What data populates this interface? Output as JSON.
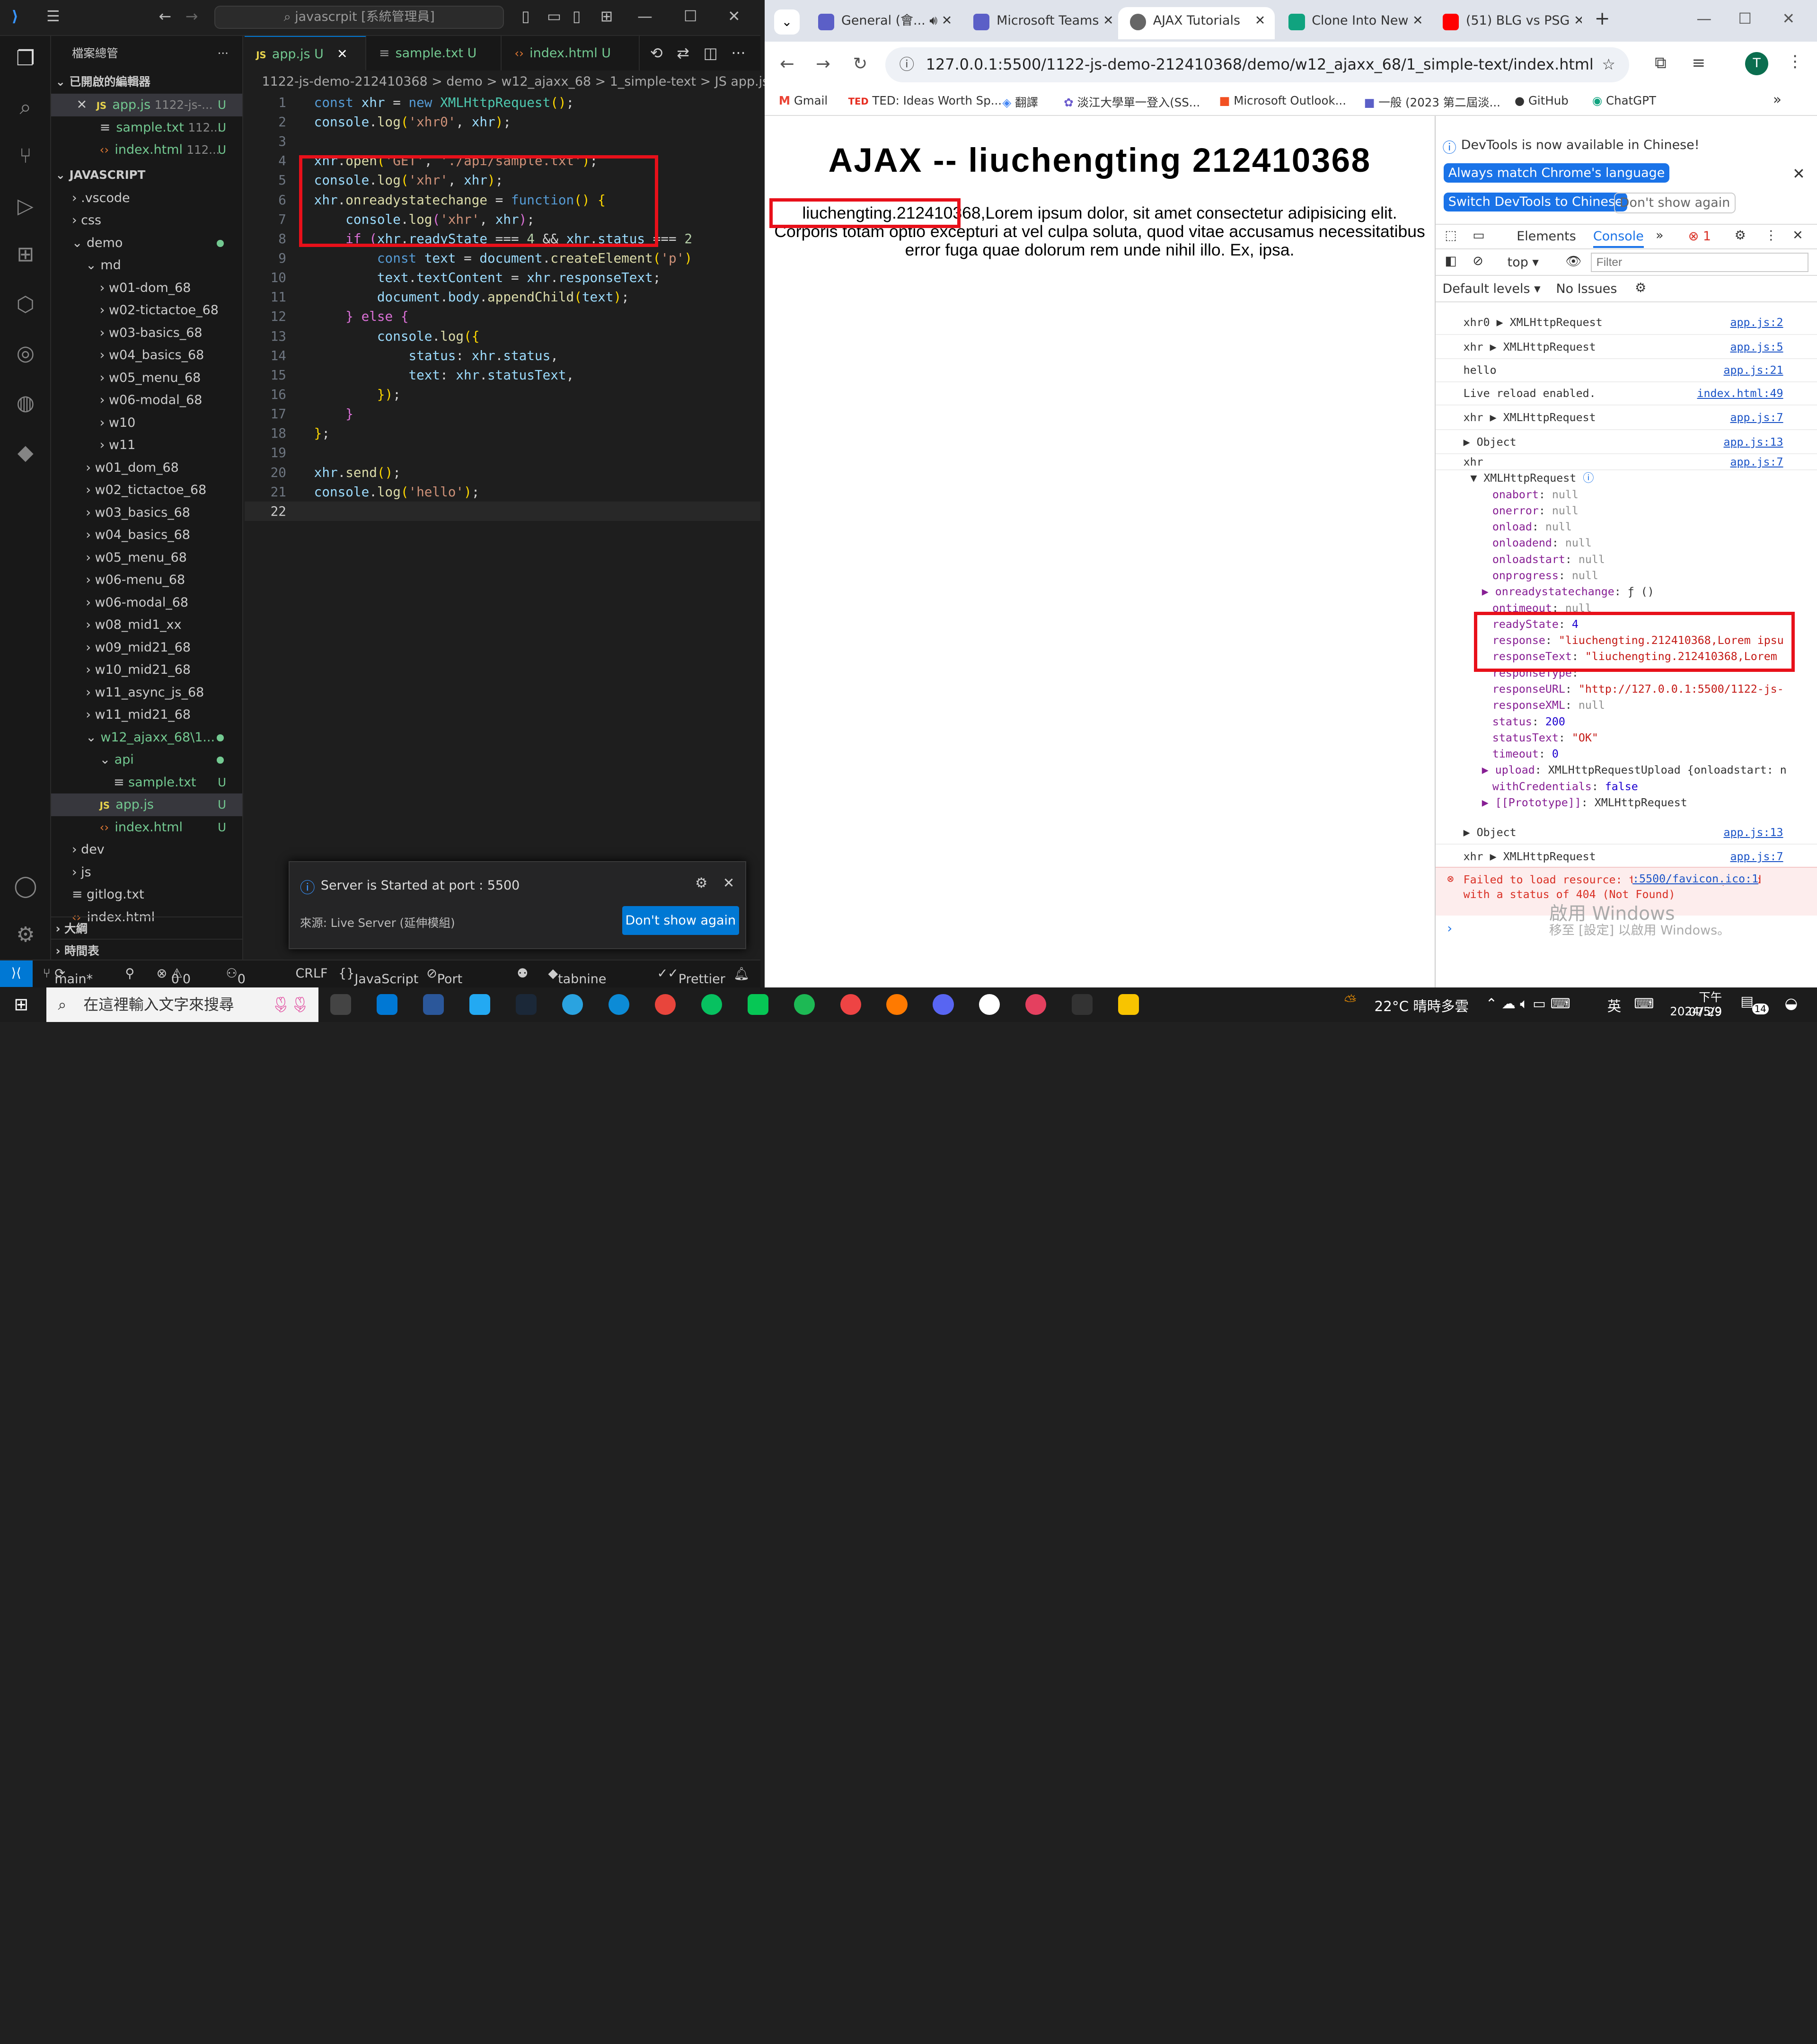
{
  "vscode": {
    "search_text": "javascrpit [系統管理員]",
    "explorer_label": "檔案總管",
    "open_editors_label": "已開啟的編輯器",
    "open_editors": [
      {
        "name": "app.js",
        "path": "1122-js-...",
        "status": "U"
      },
      {
        "name": "sample.txt",
        "path": "112...",
        "status": "U"
      },
      {
        "name": "index.html",
        "path": "112...",
        "status": "U"
      }
    ],
    "workspace_label": "JAVASCRIPT",
    "tree": [
      ".vscode",
      "css",
      "demo",
      "md",
      "w01-dom_68",
      "w02-tictactoe_68",
      "w03-basics_68",
      "w04_basics_68",
      "w05_menu_68",
      "w06-modal_68",
      "w10",
      "w11",
      "w01_dom_68",
      "w02_tictactoe_68",
      "w03_basics_68",
      "w04_basics_68",
      "w05_menu_68",
      "w06-menu_68",
      "w06-modal_68",
      "w08_mid1_xx",
      "w09_mid21_68",
      "w10_mid21_68",
      "w11_async_js_68",
      "w11_mid21_68",
      "w12_ajaxx_68\\1...",
      "api",
      "sample.txt",
      "app.js",
      "index.html",
      "dev",
      "js",
      "gitlog.txt",
      "index.html"
    ],
    "outline_label": "大綱",
    "timeline_label": "時間表",
    "tabs": [
      {
        "name": "app.js",
        "status": "U"
      },
      {
        "name": "sample.txt",
        "status": "U"
      },
      {
        "name": "index.html",
        "status": "U"
      }
    ],
    "breadcrumb": "1122-js-demo-212410368 > demo > w12_ajaxx_68 > 1_simple-text > JS app.js > ...",
    "code_lines": [
      "1",
      "2",
      "3",
      "4",
      "5",
      "6",
      "7",
      "8",
      "9",
      "10",
      "11",
      "12",
      "13",
      "14",
      "15",
      "16",
      "17",
      "18",
      "19",
      "20",
      "21",
      "22"
    ],
    "notification": {
      "message": "Server is Started at port : 5500",
      "source": "來源: Live Server (延伸模組)",
      "button": "Don't show again"
    },
    "status": {
      "branch": "main*",
      "errors": "0",
      "warnings": "0",
      "ports": "0",
      "eol": "CRLF",
      "language": "JavaScript",
      "port": "Port : 5500",
      "tabnine": "tabnine starter",
      "prettier": "Prettier"
    }
  },
  "chrome": {
    "tabs": [
      "General (會...",
      "Microsoft Teams",
      "AJAX Tutorials",
      "Clone Into New",
      "(51) BLG vs PSG"
    ],
    "url": "127.0.0.1:5500/1122-js-demo-212410368/demo/w12_ajaxx_68/1_simple-text/index.html",
    "profile_initial": "T",
    "bookmarks": [
      "Gmail",
      "TED: Ideas Worth Sp...",
      "翻譯",
      "淡江大學單一登入(SS...",
      "Microsoft Outlook...",
      "一般 (2023 第二屆淡...",
      "GitHub",
      "ChatGPT"
    ],
    "page": {
      "title": "AJAX -- liuchengting 212410368",
      "highlight": "liuchengting.212410368,",
      "body": "Lorem ipsum dolor, sit amet consectetur adipisicing elit. Corporis totam optio excepturi at vel culpa soluta, quod vitae accusamus necessitatibus error fuga quae dolorum rem unde nihil illo. Ex, ipsa."
    },
    "devtools": {
      "banner": "DevTools is now available in Chinese!",
      "btn_match": "Always match Chrome's language",
      "btn_switch": "Switch DevTools to Chinese",
      "btn_dont": "Don't show again",
      "tab_elements": "Elements",
      "tab_console": "Console",
      "error_count": "1",
      "context": "top",
      "filter_placeholder": "Filter",
      "levels": "Default levels",
      "issues": "No Issues",
      "logs": [
        {
          "text": "xhr0  ▶ XMLHttpRequest",
          "src": "app.js:2"
        },
        {
          "text": "xhr  ▶ XMLHttpRequest",
          "src": "app.js:5"
        },
        {
          "text": "hello",
          "src": "app.js:21"
        },
        {
          "text": "Live reload enabled.",
          "src": "index.html:49"
        },
        {
          "text": "xhr  ▶ XMLHttpRequest",
          "src": "app.js:7"
        },
        {
          "text": "▶ Object",
          "src": "app.js:13"
        },
        {
          "text": "xhr",
          "src": "app.js:7"
        }
      ],
      "xhr_label": "▼ XMLHttpRequest",
      "props": [
        {
          "k": "onabort",
          "v": "null",
          "t": "n"
        },
        {
          "k": "onerror",
          "v": "null",
          "t": "n"
        },
        {
          "k": "onload",
          "v": "null",
          "t": "n"
        },
        {
          "k": "onloadend",
          "v": "null",
          "t": "n"
        },
        {
          "k": "onloadstart",
          "v": "null",
          "t": "n"
        },
        {
          "k": "onprogress",
          "v": "null",
          "t": "n"
        },
        {
          "k": "▶ onreadystatechange",
          "v": "ƒ ()",
          "t": "f"
        },
        {
          "k": "ontimeout",
          "v": "null",
          "t": "n"
        },
        {
          "k": "readyState",
          "v": "4",
          "t": "num"
        },
        {
          "k": "response",
          "v": "\"liuchengting.212410368,Lorem ipsu",
          "t": "s"
        },
        {
          "k": "responseText",
          "v": "\"liuchengting.212410368,Lorem",
          "t": "s"
        },
        {
          "k": "responseType",
          "v": "\"\"",
          "t": "s"
        },
        {
          "k": "responseURL",
          "v": "\"http://127.0.0.1:5500/1122-js-",
          "t": "s"
        },
        {
          "k": "responseXML",
          "v": "null",
          "t": "n"
        },
        {
          "k": "status",
          "v": "200",
          "t": "num"
        },
        {
          "k": "statusText",
          "v": "\"OK\"",
          "t": "s"
        },
        {
          "k": "timeout",
          "v": "0",
          "t": "num"
        },
        {
          "k": "▶ upload",
          "v": "XMLHttpRequestUpload {onloadstart: n",
          "t": "f"
        },
        {
          "k": "withCredentials",
          "v": "false",
          "t": "num"
        },
        {
          "k": "▶ [[Prototype]]",
          "v": "XMLHttpRequest",
          "t": "f"
        }
      ],
      "tail_logs": [
        {
          "text": "▶ Object",
          "src": "app.js:13"
        },
        {
          "text": "xhr  ▶ XMLHttpRequest",
          "src": "app.js:7"
        }
      ],
      "error": "Failed to load resource: the server responded with a status of 404 (Not Found)",
      "error_src": ":5500/favicon.ico:1",
      "watermark1": "啟用 Windows",
      "watermark2": "移至 [設定] 以啟用 Windows。"
    }
  },
  "taskbar": {
    "search_placeholder": "在這裡輸入文字來搜尋",
    "weather": "22°C 晴時多雲",
    "ime": "英",
    "time": "下午 07:29",
    "date": "2024/5/9",
    "notif_count": "14"
  },
  "colors": {
    "accent": "#0078d4",
    "highlight_box": "#e8101a",
    "git_untracked": "#73c991"
  }
}
